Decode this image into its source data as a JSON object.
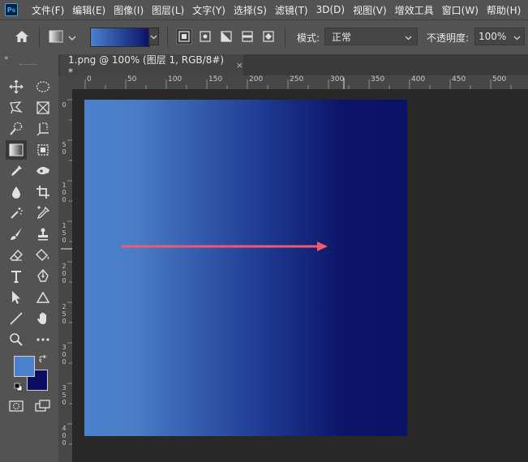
{
  "app": {
    "logo": "Ps"
  },
  "menu": [
    "文件(F)",
    "编辑(E)",
    "图像(I)",
    "图层(L)",
    "文字(Y)",
    "选择(S)",
    "滤镜(T)",
    "3D(D)",
    "视图(V)",
    "增效工具",
    "窗口(W)",
    "帮助(H)"
  ],
  "options": {
    "mode_label": "模式:",
    "mode_value": "正常",
    "opacity_label": "不透明度:",
    "opacity_value": "100%",
    "gradient_from": "#4a80cc",
    "gradient_to": "#0a1266"
  },
  "document": {
    "tab_title": "1.png @ 100% (图层 1, RGB/8#) *",
    "close": "×"
  },
  "ruler": {
    "top_ticks": [
      "0",
      "50",
      "100",
      "150",
      "200",
      "250",
      "300",
      "350",
      "400",
      "450",
      "500"
    ],
    "left_ticks": [
      "0",
      "5 0",
      "1 0 0",
      "1 5 0",
      "2 0 0",
      "2 5 0",
      "3 0 0",
      "3 5 0",
      "4 0 0"
    ]
  },
  "colors": {
    "foreground": "#4a80cc",
    "background": "#0a0e62",
    "arrow": "#f05a6e"
  }
}
